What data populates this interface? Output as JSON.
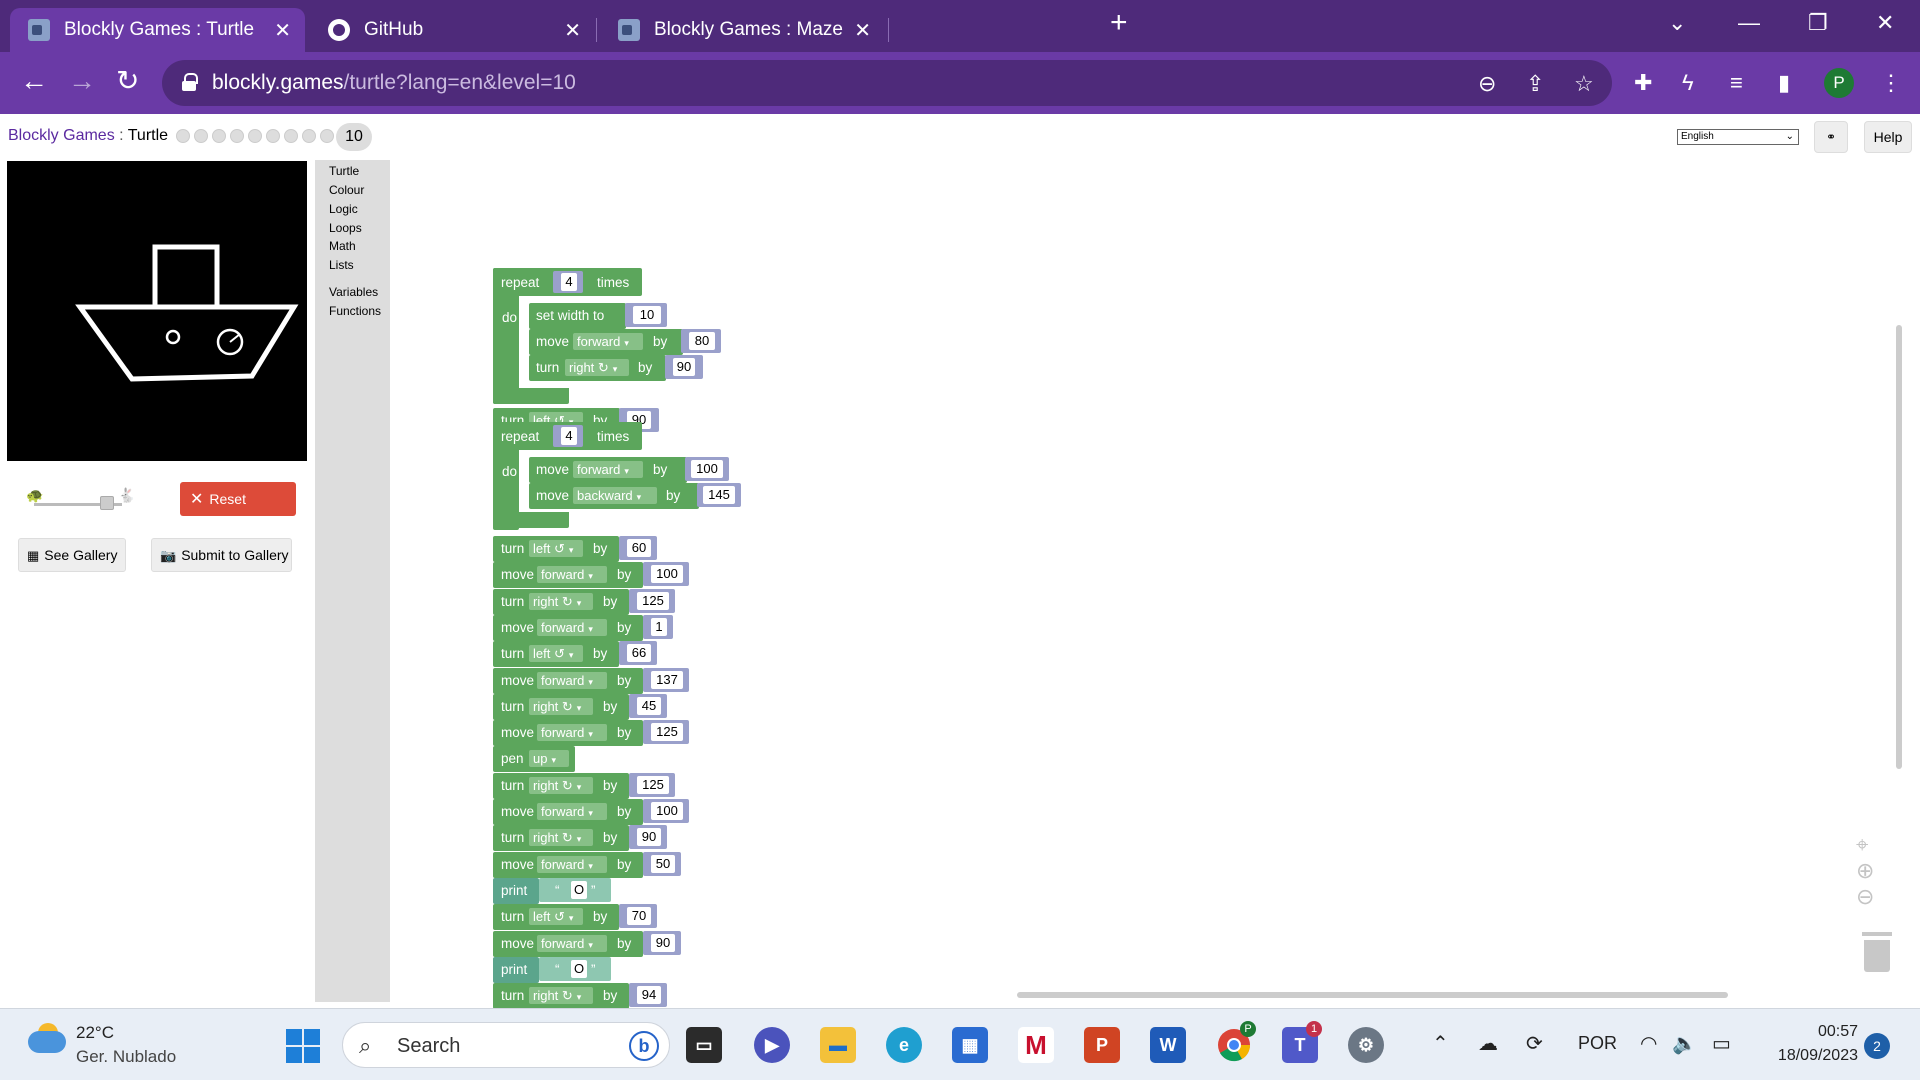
{
  "browser": {
    "tabs": [
      {
        "title": "Blockly Games : Turtle",
        "active": true
      },
      {
        "title": "GitHub",
        "active": false
      },
      {
        "title": "Blockly Games : Maze",
        "active": false
      }
    ],
    "new_tab_label": "+",
    "url_host": "blockly.games",
    "url_path": "/turtle?lang=en&level=10",
    "profile_initial": "P"
  },
  "header": {
    "site": "Blockly Games",
    "separator": " : ",
    "app": "Turtle",
    "level": "10",
    "language": "English",
    "link_label": "⚭",
    "help_label": "Help"
  },
  "controls": {
    "reset_label": "Reset",
    "see_gallery_label": "See Gallery",
    "submit_gallery_label": "Submit to Gallery"
  },
  "toolbox": {
    "categories": [
      "Turtle",
      "Colour",
      "Logic",
      "Loops",
      "Math",
      "Lists",
      "Variables",
      "Functions"
    ]
  },
  "blocks": {
    "repeat1": {
      "kw": "repeat",
      "count": "4",
      "times": "times",
      "do": "do"
    },
    "r1_setwidth": {
      "kw": "set width to",
      "value": "10"
    },
    "r1_move": {
      "kw": "move",
      "dir": "forward",
      "by": "by",
      "value": "80"
    },
    "r1_turn": {
      "kw": "turn",
      "dir": "right ↻",
      "by": "by",
      "value": "90"
    },
    "turn_a": {
      "kw": "turn",
      "dir": "left ↺",
      "by": "by",
      "value": "90"
    },
    "repeat2": {
      "kw": "repeat",
      "count": "4",
      "times": "times",
      "do": "do"
    },
    "r2_move1": {
      "kw": "move",
      "dir": "forward",
      "by": "by",
      "value": "100"
    },
    "r2_move2": {
      "kw": "move",
      "dir": "backward",
      "by": "by",
      "value": "145"
    },
    "seq": [
      {
        "kw": "turn",
        "dir": "left ↺",
        "by": "by",
        "value": "60"
      },
      {
        "kw": "move",
        "dir": "forward",
        "by": "by",
        "value": "100"
      },
      {
        "kw": "turn",
        "dir": "right ↻",
        "by": "by",
        "value": "125"
      },
      {
        "kw": "move",
        "dir": "forward",
        "by": "by",
        "value": "1"
      },
      {
        "kw": "turn",
        "dir": "left ↺",
        "by": "by",
        "value": "66"
      },
      {
        "kw": "move",
        "dir": "forward",
        "by": "by",
        "value": "137"
      },
      {
        "kw": "turn",
        "dir": "right ↻",
        "by": "by",
        "value": "45"
      },
      {
        "kw": "move",
        "dir": "forward",
        "by": "by",
        "value": "125"
      },
      {
        "kw": "pen",
        "dir": "up",
        "by": "",
        "value": ""
      },
      {
        "kw": "turn",
        "dir": "right ↻",
        "by": "by",
        "value": "125"
      },
      {
        "kw": "move",
        "dir": "forward",
        "by": "by",
        "value": "100"
      },
      {
        "kw": "turn",
        "dir": "right ↻",
        "by": "by",
        "value": "90"
      },
      {
        "kw": "move",
        "dir": "forward",
        "by": "by",
        "value": "50"
      },
      {
        "kw": "print",
        "dir": "",
        "by": "",
        "value": "O"
      },
      {
        "kw": "turn",
        "dir": "left ↺",
        "by": "by",
        "value": "70"
      },
      {
        "kw": "move",
        "dir": "forward",
        "by": "by",
        "value": "90"
      },
      {
        "kw": "print",
        "dir": "",
        "by": "",
        "value": "O"
      },
      {
        "kw": "turn",
        "dir": "right ↻",
        "by": "by",
        "value": "94"
      }
    ]
  },
  "taskbar": {
    "temperature": "22°C",
    "condition": "Ger. Nublado",
    "search_placeholder": "Search",
    "language": "POR",
    "time": "00:57",
    "date": "18/09/2023",
    "notifications": "2",
    "chrome_badge": "P",
    "teams_badge": "1"
  }
}
